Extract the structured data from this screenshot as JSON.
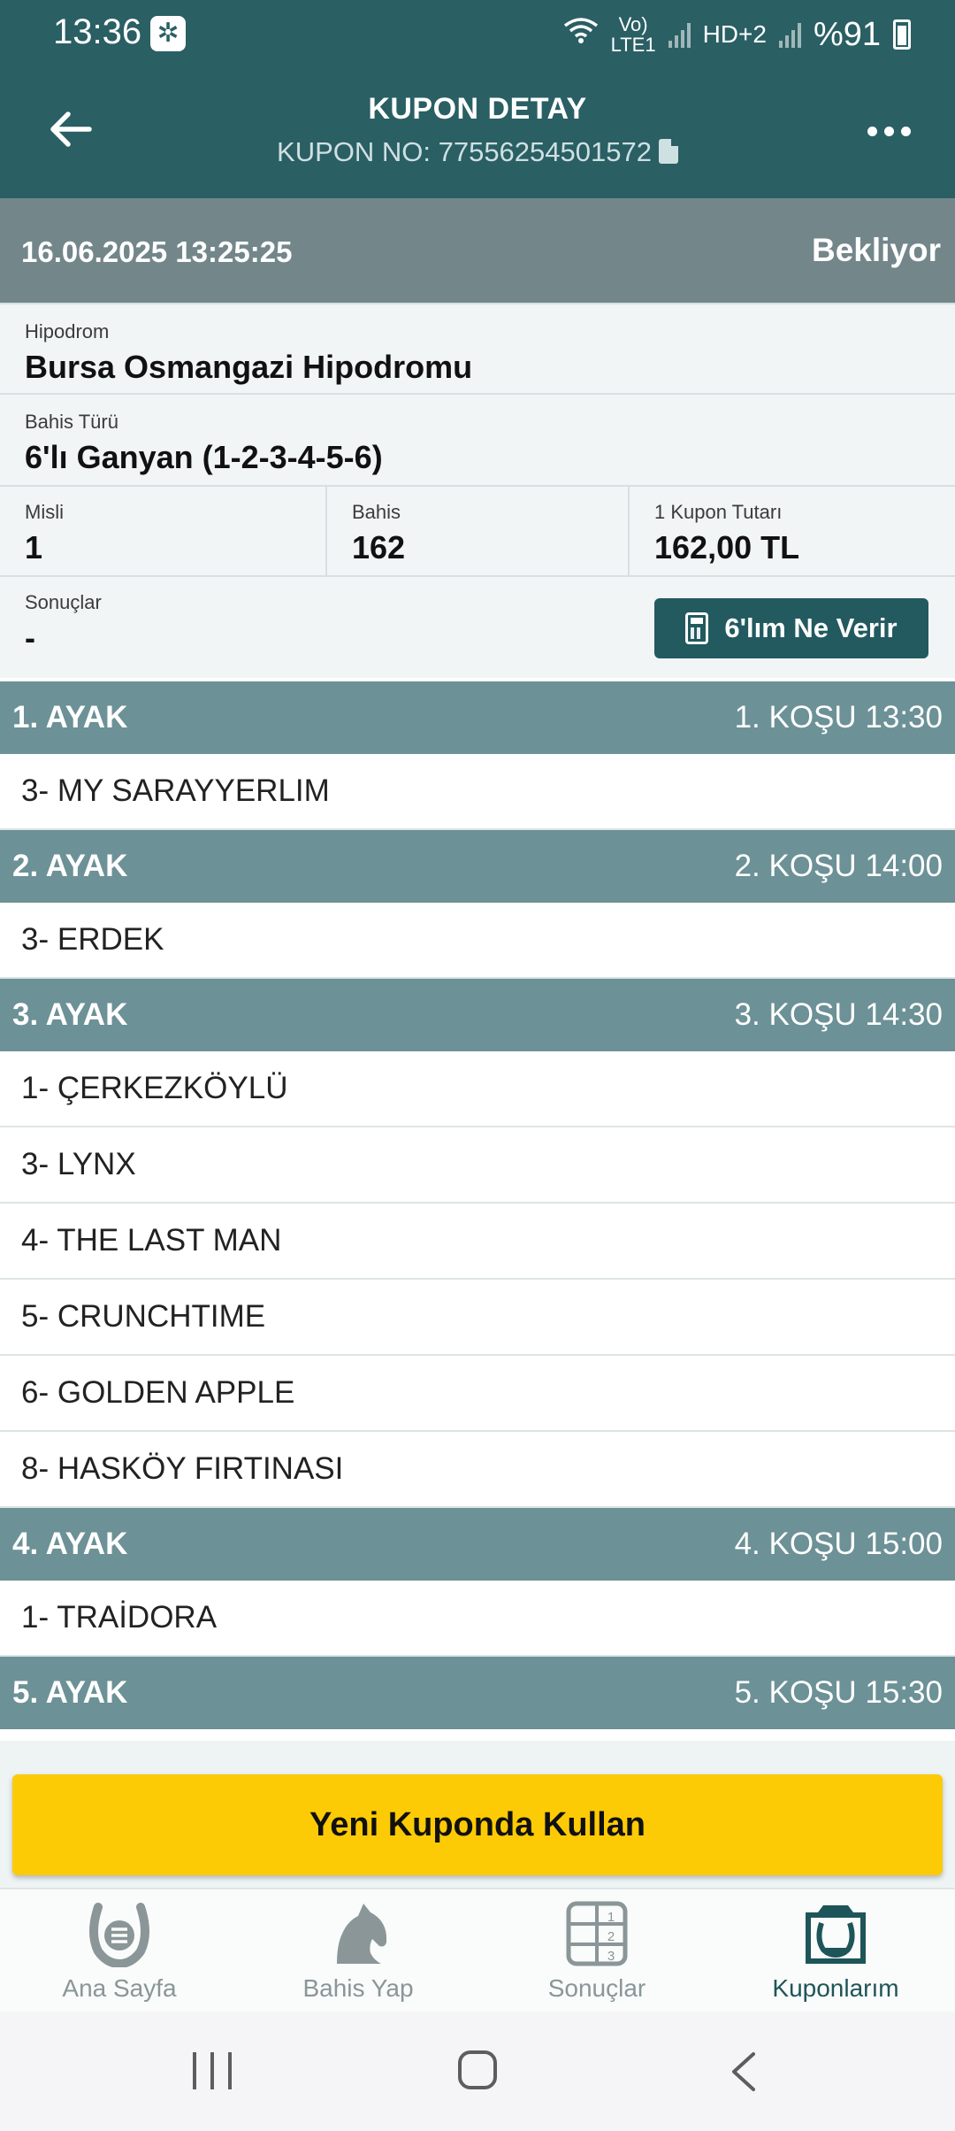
{
  "status_bar": {
    "time": "13:36",
    "network_label": "Vo)\nLTE1",
    "hd_label": "HD+2",
    "battery": "%91"
  },
  "header": {
    "title": "KUPON DETAY",
    "subtitle": "KUPON NO: 77556254501572"
  },
  "coupon": {
    "date": "16.06.2025 13:25:25",
    "state": "Bekliyor",
    "hippodrome_label": "Hipodrom",
    "hippodrome": "Bursa Osmangazi Hipodromu",
    "bet_type_label": "Bahis Türü",
    "bet_type": "6'lı Ganyan (1-2-3-4-5-6)",
    "multiplier_label": "Misli",
    "multiplier": "1",
    "bets_label": "Bahis",
    "bets": "162",
    "amount_label": "1 Kupon Tutarı",
    "amount": "162,00 TL",
    "results_label": "Sonuçlar",
    "results": "-",
    "calc_button": "6'lım Ne Verir"
  },
  "legs": [
    {
      "name": "1. AYAK",
      "race": "1. KOŞU 13:30",
      "horses": [
        "3- MY SARAYYERLIM"
      ]
    },
    {
      "name": "2. AYAK",
      "race": "2. KOŞU 14:00",
      "horses": [
        "3- ERDEK"
      ]
    },
    {
      "name": "3. AYAK",
      "race": "3. KOŞU 14:30",
      "horses": [
        "1- ÇERKEZKÖYLÜ",
        "3- LYNX",
        "4- THE LAST MAN",
        "5- CRUNCHTIME",
        "6- GOLDEN APPLE",
        "8- HASKÖY FIRTINASI"
      ]
    },
    {
      "name": "4. AYAK",
      "race": "4. KOŞU 15:00",
      "horses": [
        "1- TRAİDORA"
      ]
    },
    {
      "name": "5. AYAK",
      "race": "5. KOŞU 15:30",
      "horses": []
    }
  ],
  "action_button": "Yeni Kuponda Kullan",
  "tabs": [
    {
      "label": "Ana Sayfa",
      "icon": "horseshoe-icon",
      "active": false
    },
    {
      "label": "Bahis Yap",
      "icon": "horse-head-icon",
      "active": false
    },
    {
      "label": "Sonuçlar",
      "icon": "results-grid-icon",
      "active": false
    },
    {
      "label": "Kuponlarım",
      "icon": "coupons-icon",
      "active": true
    }
  ],
  "colors": {
    "header": "#2a5f64",
    "date_row": "#73878b",
    "leg_header": "#6c9196",
    "action": "#fccb05",
    "active_tab": "#1e5559",
    "inactive_tab": "#8a9698"
  }
}
